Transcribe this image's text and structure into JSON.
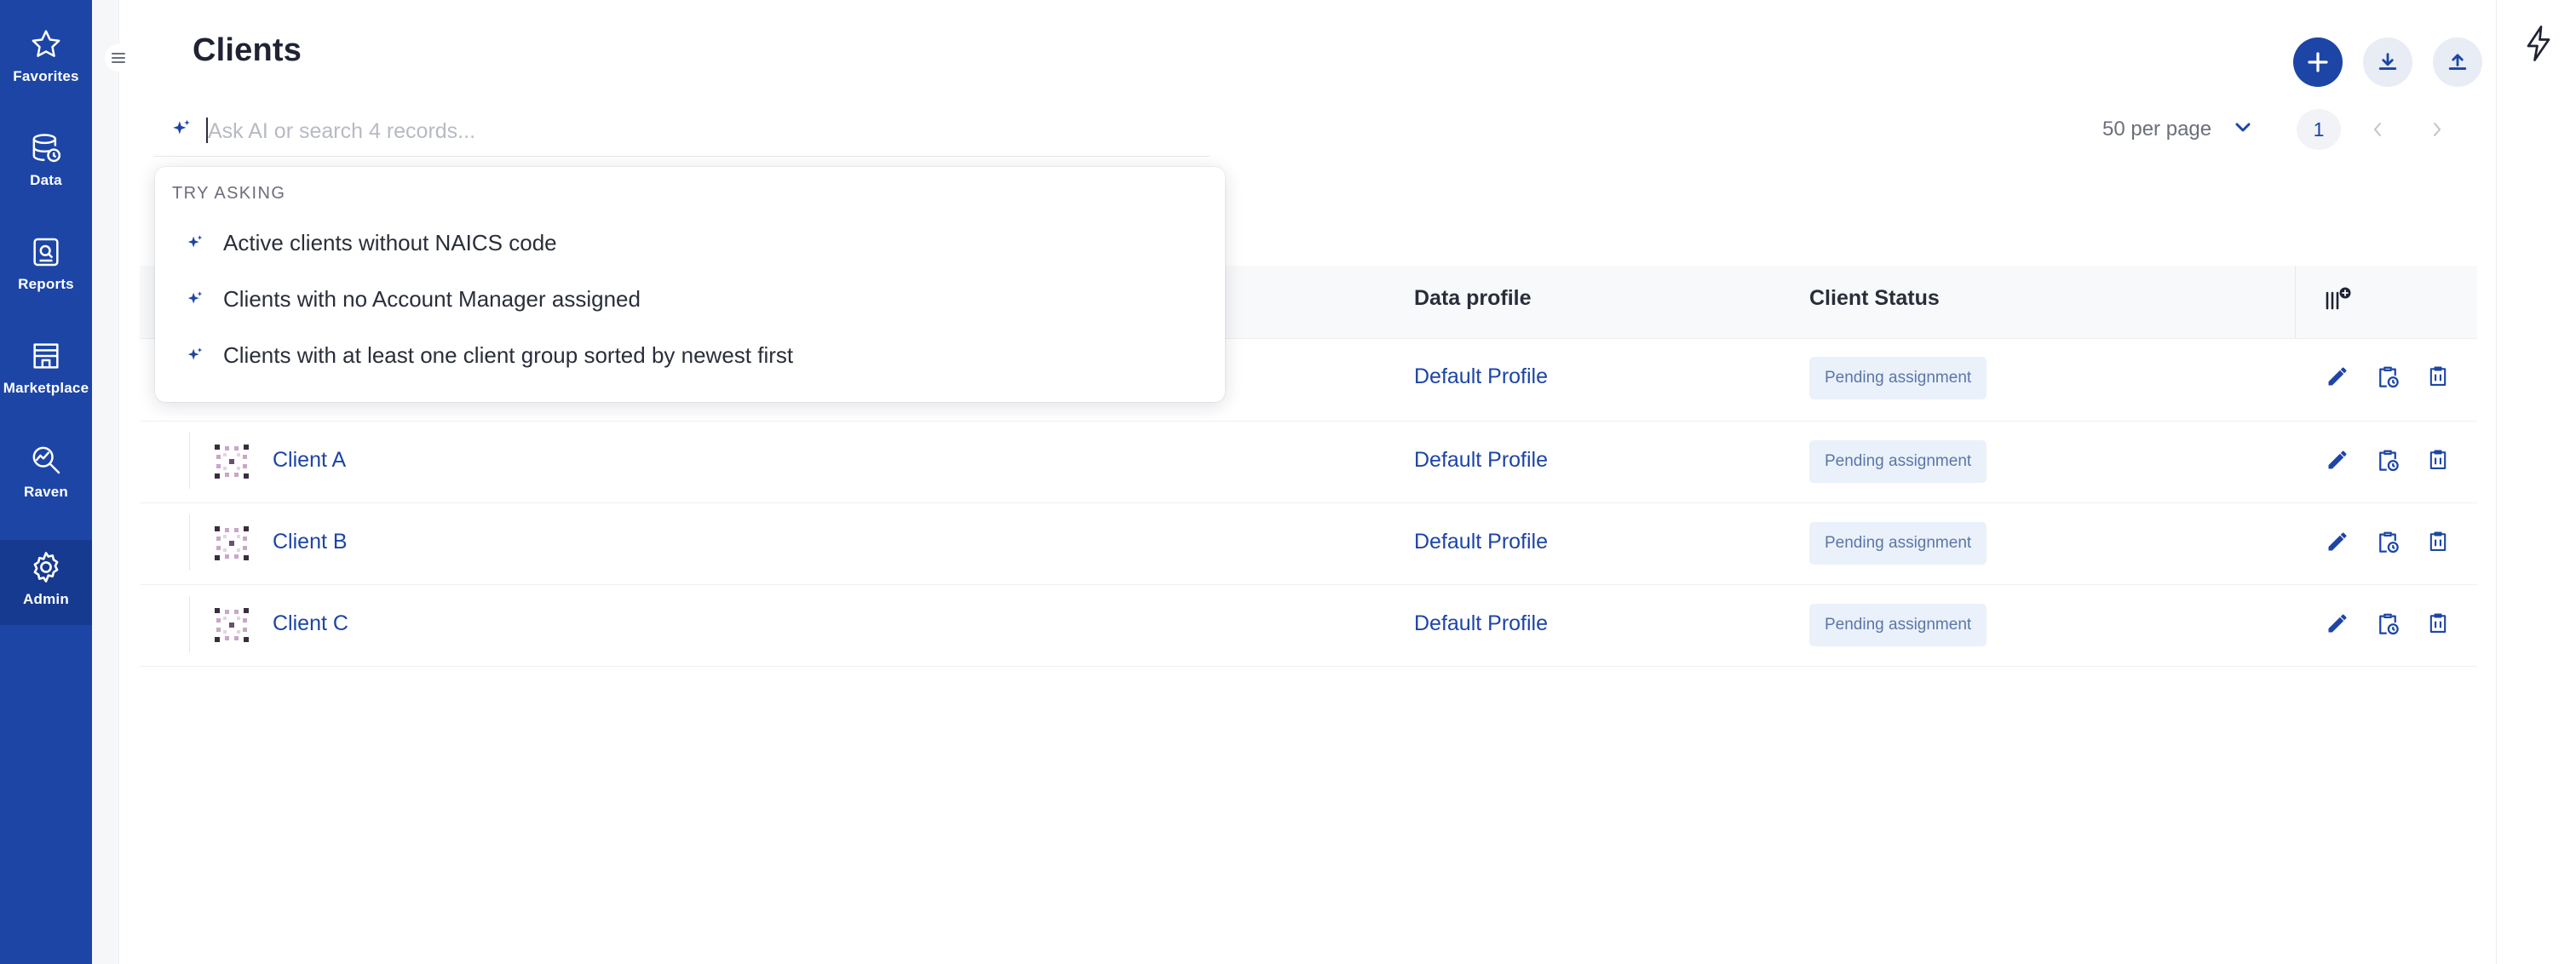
{
  "app": {
    "page_title": "Clients"
  },
  "sidenav": {
    "items": [
      {
        "label": "Favorites",
        "icon": "star-icon"
      },
      {
        "label": "Data",
        "icon": "database-icon"
      },
      {
        "label": "Reports",
        "icon": "reports-icon"
      },
      {
        "label": "Marketplace",
        "icon": "store-icon"
      },
      {
        "label": "Raven",
        "icon": "raven-icon"
      },
      {
        "label": "Admin",
        "icon": "gear-icon",
        "active": true
      }
    ]
  },
  "toolbar": {
    "add_icon": "plus-icon",
    "download_icon": "download-icon",
    "upload_icon": "upload-icon",
    "right_icon": "bolt-icon"
  },
  "search": {
    "value": "",
    "placeholder": "Ask AI or search 4 records..."
  },
  "pagination": {
    "per_page": "50 per page",
    "current_page": "1"
  },
  "suggestions": {
    "heading": "Try asking",
    "items": [
      "Active clients without NAICS code",
      "Clients with no Account Manager assigned",
      "Clients with at least one client group sorted by newest first"
    ]
  },
  "table": {
    "columns": [
      "Data profile",
      "Client Status"
    ],
    "rows": [
      {
        "name": "",
        "profile": "Default Profile",
        "status": "Pending assignment"
      },
      {
        "name": "Client A",
        "profile": "Default Profile",
        "status": "Pending assignment"
      },
      {
        "name": "Client B",
        "profile": "Default Profile",
        "status": "Pending assignment"
      },
      {
        "name": "Client C",
        "profile": "Default Profile",
        "status": "Pending assignment"
      }
    ],
    "row_actions": [
      "edit-icon",
      "clipboard-clock-icon",
      "delete-icon"
    ]
  },
  "colors": {
    "brand": "#1c45a6",
    "badge_bg": "#eaf1fb",
    "badge_text": "#5b76a8"
  }
}
